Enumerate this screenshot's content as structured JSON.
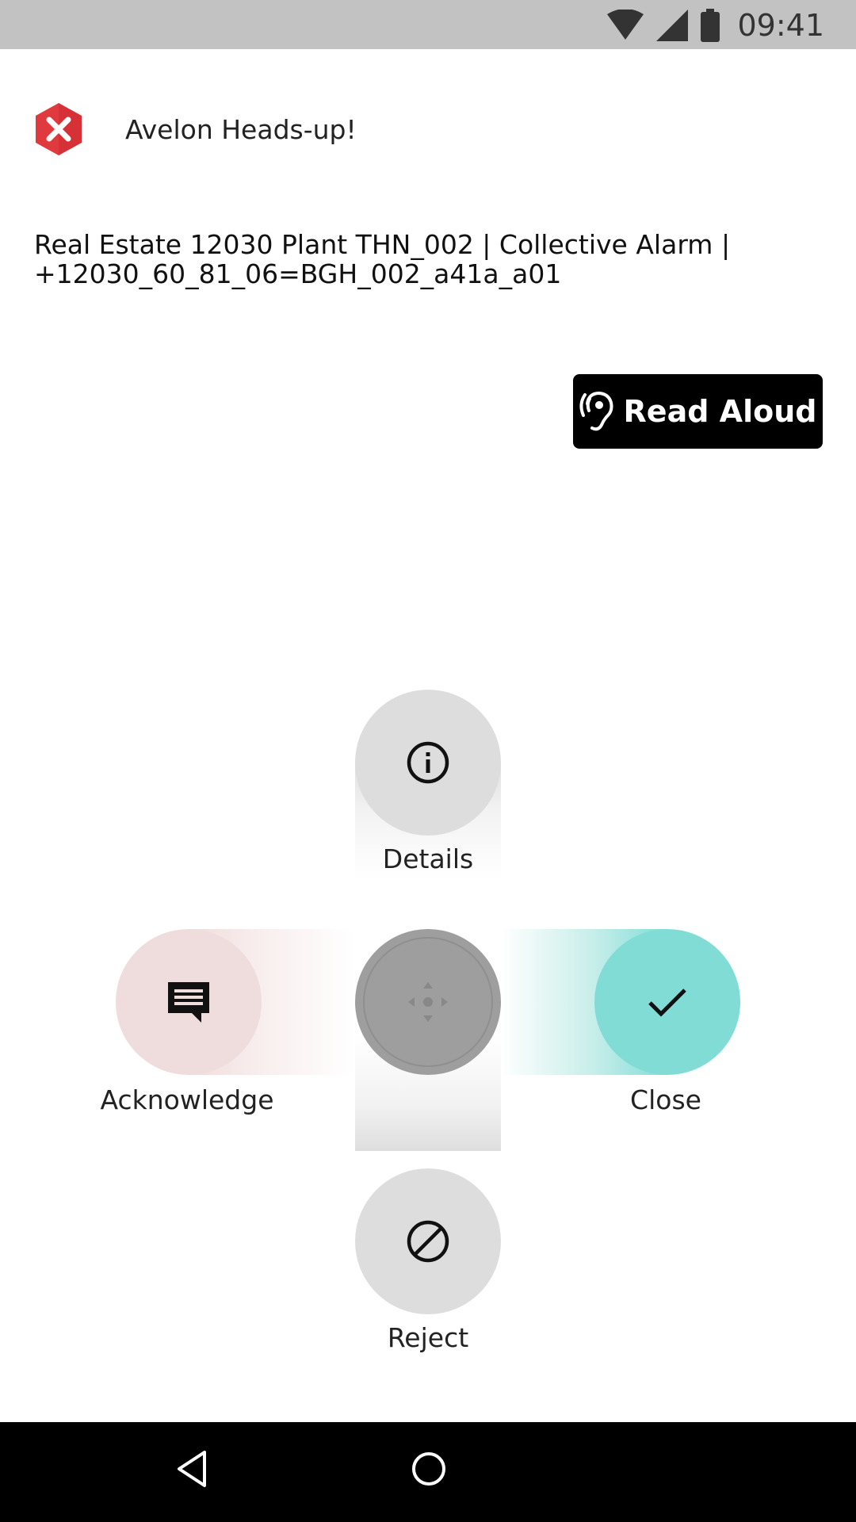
{
  "status_bar": {
    "time": "09:41",
    "icons": [
      "wifi-icon",
      "cell-signal-icon",
      "battery-icon"
    ]
  },
  "header": {
    "logo": "error-hexagon-icon",
    "title": "Avelon Heads-up!"
  },
  "alarm": {
    "message_line1": "Real Estate 12030 Plant THN_002 | Collective Alarm |",
    "message_line2": "+12030_60_81_06=BGH_002_a41a_a01"
  },
  "read_aloud": {
    "label": "Read Aloud",
    "icon": "hearing-icon"
  },
  "actions": {
    "details": {
      "label": "Details",
      "icon": "info-icon"
    },
    "acknowledge": {
      "label": "Acknowledge",
      "icon": "comment-icon"
    },
    "close": {
      "label": "Close",
      "icon": "check-icon"
    },
    "reject": {
      "label": "Reject",
      "icon": "block-icon"
    },
    "handle": {
      "icon": "move-icon"
    }
  },
  "colors": {
    "status_bar": "#c2c2c2",
    "logo_red": "#e0393e",
    "close_teal": "#82dcd6",
    "acknowledge_pink": "#efdcdc",
    "neutral_circle": "#dddddd",
    "handle_gray": "#9e9e9e"
  },
  "nav_bar": {
    "icons": [
      "back-icon",
      "home-icon"
    ]
  }
}
